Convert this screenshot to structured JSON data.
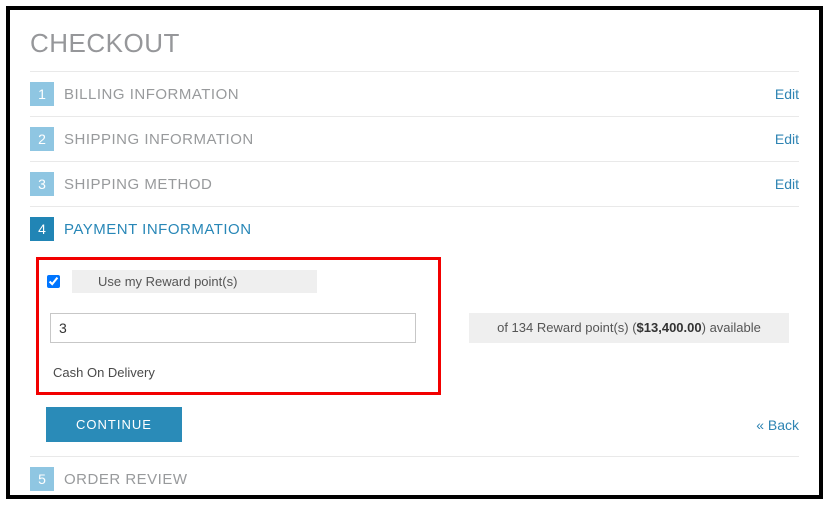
{
  "page": {
    "title": "CHECKOUT"
  },
  "steps": {
    "s1": {
      "num": "1",
      "title": "BILLING INFORMATION",
      "edit": "Edit"
    },
    "s2": {
      "num": "2",
      "title": "SHIPPING INFORMATION",
      "edit": "Edit"
    },
    "s3": {
      "num": "3",
      "title": "SHIPPING METHOD",
      "edit": "Edit"
    },
    "s4": {
      "num": "4",
      "title": "PAYMENT INFORMATION"
    },
    "s5": {
      "num": "5",
      "title": "ORDER REVIEW"
    }
  },
  "payment": {
    "use_rewards_label": "Use my Reward point(s)",
    "points_value": "3",
    "available_prefix": "of 134 Reward point(s) (",
    "available_amount": "$13,400.00",
    "available_suffix": ") available",
    "method": "Cash On Delivery",
    "continue_label": "CONTINUE",
    "back_label": "« Back"
  }
}
